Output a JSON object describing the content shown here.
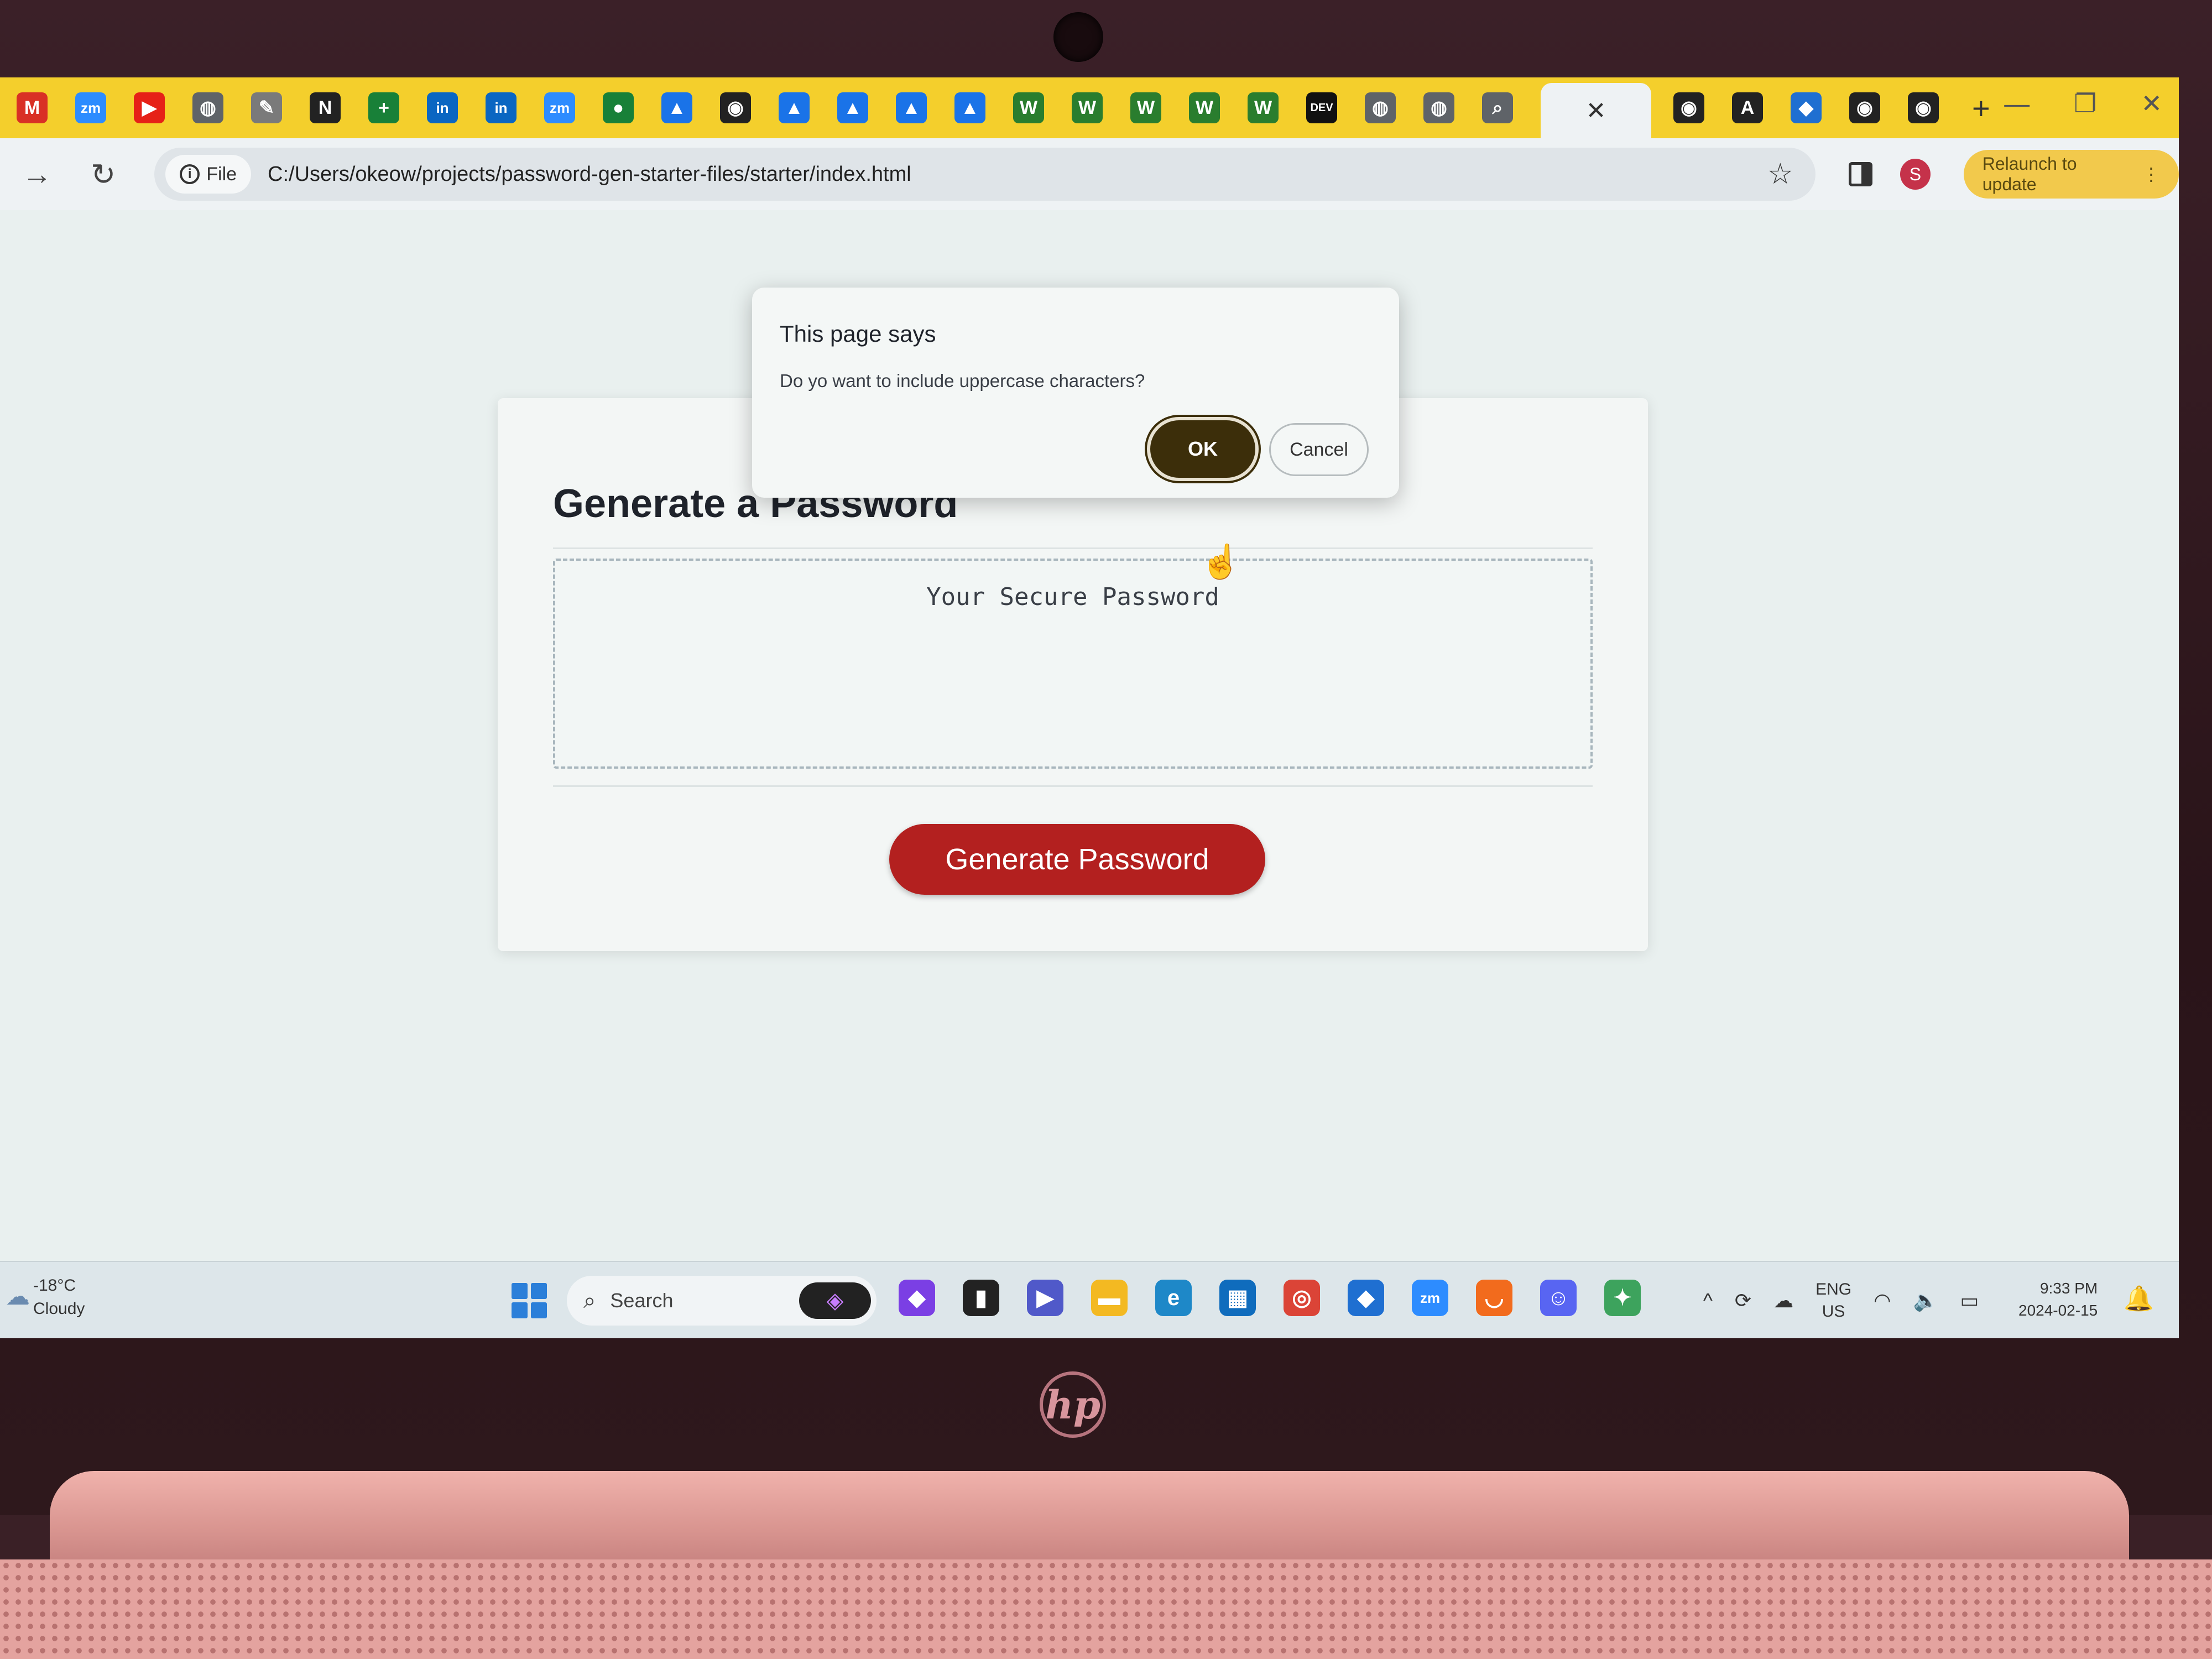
{
  "browser": {
    "tabs": [
      {
        "icon": "gmail-icon",
        "color": "#d93025",
        "glyph": "M"
      },
      {
        "icon": "zoom-icon",
        "color": "#2d8cff",
        "glyph": "zm"
      },
      {
        "icon": "youtube-icon",
        "color": "#e62117",
        "glyph": "▶"
      },
      {
        "icon": "globe-icon",
        "color": "#5f6368",
        "glyph": "◍"
      },
      {
        "icon": "pen-icon",
        "color": "#7a7a7a",
        "glyph": "✎"
      },
      {
        "icon": "notion-icon",
        "color": "#222222",
        "glyph": "N"
      },
      {
        "icon": "sheets-icon",
        "color": "#188038",
        "glyph": "+"
      },
      {
        "icon": "linkedin-icon",
        "color": "#0a66c2",
        "glyph": "in"
      },
      {
        "icon": "linkedin-icon",
        "color": "#0a66c2",
        "glyph": "in"
      },
      {
        "icon": "zoom-icon",
        "color": "#2d8cff",
        "glyph": "zm"
      },
      {
        "icon": "classroom-icon",
        "color": "#188038",
        "glyph": "●"
      },
      {
        "icon": "drive-icon",
        "color": "#1a73e8",
        "glyph": "▲"
      },
      {
        "icon": "github-icon",
        "color": "#222222",
        "glyph": "◉"
      },
      {
        "icon": "drive-icon",
        "color": "#1a73e8",
        "glyph": "▲"
      },
      {
        "icon": "drive-icon",
        "color": "#1a73e8",
        "glyph": "▲"
      },
      {
        "icon": "drive-icon",
        "color": "#1a73e8",
        "glyph": "▲"
      },
      {
        "icon": "drive-icon",
        "color": "#1a73e8",
        "glyph": "▲"
      },
      {
        "icon": "webflow-icon",
        "color": "#2a7d2e",
        "glyph": "W"
      },
      {
        "icon": "webflow-icon",
        "color": "#2a7d2e",
        "glyph": "W"
      },
      {
        "icon": "webflow-icon",
        "color": "#2a7d2e",
        "glyph": "W"
      },
      {
        "icon": "webflow-icon",
        "color": "#2a7d2e",
        "glyph": "W"
      },
      {
        "icon": "webflow-icon",
        "color": "#2a7d2e",
        "glyph": "W"
      },
      {
        "icon": "dev-icon",
        "color": "#111111",
        "glyph": "DEV"
      },
      {
        "icon": "globe-icon",
        "color": "#5f6368",
        "glyph": "◍"
      },
      {
        "icon": "globe-icon",
        "color": "#5f6368",
        "glyph": "◍"
      },
      {
        "icon": "search-icon",
        "color": "#5f6368",
        "glyph": "⌕"
      }
    ],
    "active_tab_close": "✕",
    "tabs_after": [
      {
        "icon": "github-icon",
        "color": "#222222",
        "glyph": "◉"
      },
      {
        "icon": "app-icon",
        "color": "#222222",
        "glyph": "A"
      },
      {
        "icon": "vscode-icon",
        "color": "#1f6fd1",
        "glyph": "◆"
      },
      {
        "icon": "github-icon",
        "color": "#222222",
        "glyph": "◉"
      },
      {
        "icon": "github-icon",
        "color": "#222222",
        "glyph": "◉"
      }
    ],
    "new_tab": "+",
    "window_controls": [
      "—",
      "❐",
      "✕"
    ],
    "back": "→",
    "reload": "↻",
    "scheme_label": "File",
    "url": "C:/Users/okeow/projects/password-gen-starter-files/starter/index.html",
    "bookmark_star": "☆",
    "profile_initial": "S",
    "relaunch_label": "Relaunch to update",
    "relaunch_menu": "⋮"
  },
  "page": {
    "title": "Generate a Password",
    "password_placeholder": "Your Secure Password",
    "generate_button": "Generate Password"
  },
  "dialog": {
    "title": "This page says",
    "message": "Do yo want to include uppercase characters?",
    "ok": "OK",
    "cancel": "Cancel"
  },
  "taskbar": {
    "weather_temp": "-18°C",
    "weather_desc": "Cloudy",
    "search_label": "Search",
    "apps": [
      {
        "icon": "copilot-icon",
        "color": "#7b3fe4",
        "glyph": "◆"
      },
      {
        "icon": "terminal-icon",
        "color": "#222222",
        "glyph": "▮"
      },
      {
        "icon": "teams-icon",
        "color": "#5059c9",
        "glyph": "▶"
      },
      {
        "icon": "folder-icon",
        "color": "#f3b922",
        "glyph": "▬"
      },
      {
        "icon": "edge-icon",
        "color": "#1e88c8",
        "glyph": "e"
      },
      {
        "icon": "store-icon",
        "color": "#0f6cbd",
        "glyph": "▦"
      },
      {
        "icon": "chrome-icon",
        "color": "#db4437",
        "glyph": "◎"
      },
      {
        "icon": "vscode-icon",
        "color": "#1f6fd1",
        "glyph": "◆"
      },
      {
        "icon": "zoom-icon",
        "color": "#2d8cff",
        "glyph": "zm"
      },
      {
        "icon": "shopping-icon",
        "color": "#f26b1d",
        "glyph": "◡"
      },
      {
        "icon": "discord-icon",
        "color": "#5865f2",
        "glyph": "☺"
      },
      {
        "icon": "tool-icon",
        "color": "#3da35d",
        "glyph": "✦"
      }
    ],
    "tray_chevron": "^",
    "lang_1": "ENG",
    "lang_2": "US",
    "time": "9:33 PM",
    "date": "2024-02-15"
  },
  "hardware": {
    "logo": "hp"
  }
}
